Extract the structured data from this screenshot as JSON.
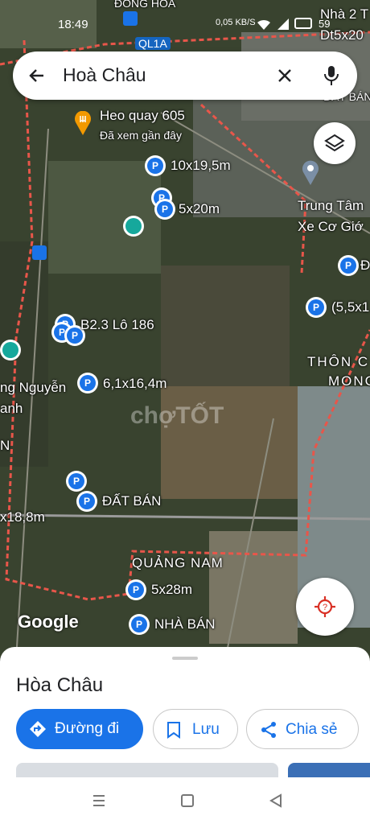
{
  "status": {
    "time": "18:49",
    "net": "0,05 KB/S",
    "battery": "59"
  },
  "search": {
    "query": "Hoà Châu"
  },
  "map": {
    "top_labels": [
      "ĐÔNG HÒA",
      "QL1A",
      "Nhà 2 T",
      "Dt5x20",
      "ĐẤT BÁN"
    ],
    "poi": {
      "name": "Heo quay 605",
      "note": "Đã xem gần đây"
    },
    "center_label": {
      "line1": "Trung Tâm",
      "line2": "Xe Cơ Giớ"
    },
    "listings": [
      "10x19,5m",
      "5x20m",
      "B2.3 Lô 186",
      "6,1x16,4m",
      "ĐẤT BÁN",
      "x18,8m",
      "5x28m",
      "NHÀ BÁN",
      "(5,5x1",
      "Đ"
    ],
    "areas": [
      "THÔN C",
      "MONG",
      "QUẢNG NAM",
      "ng Nguyễn",
      "anh",
      "N"
    ],
    "watermark": "chợTỐT",
    "attribution": "Google"
  },
  "sheet": {
    "place": "Hòa Châu",
    "buttons": {
      "directions": "Đường đi",
      "save": "Lưu",
      "share": "Chia sẻ"
    }
  },
  "colors": {
    "accent": "#1a73e8",
    "boundary": "#e8564a",
    "teal": "#16a89c"
  }
}
